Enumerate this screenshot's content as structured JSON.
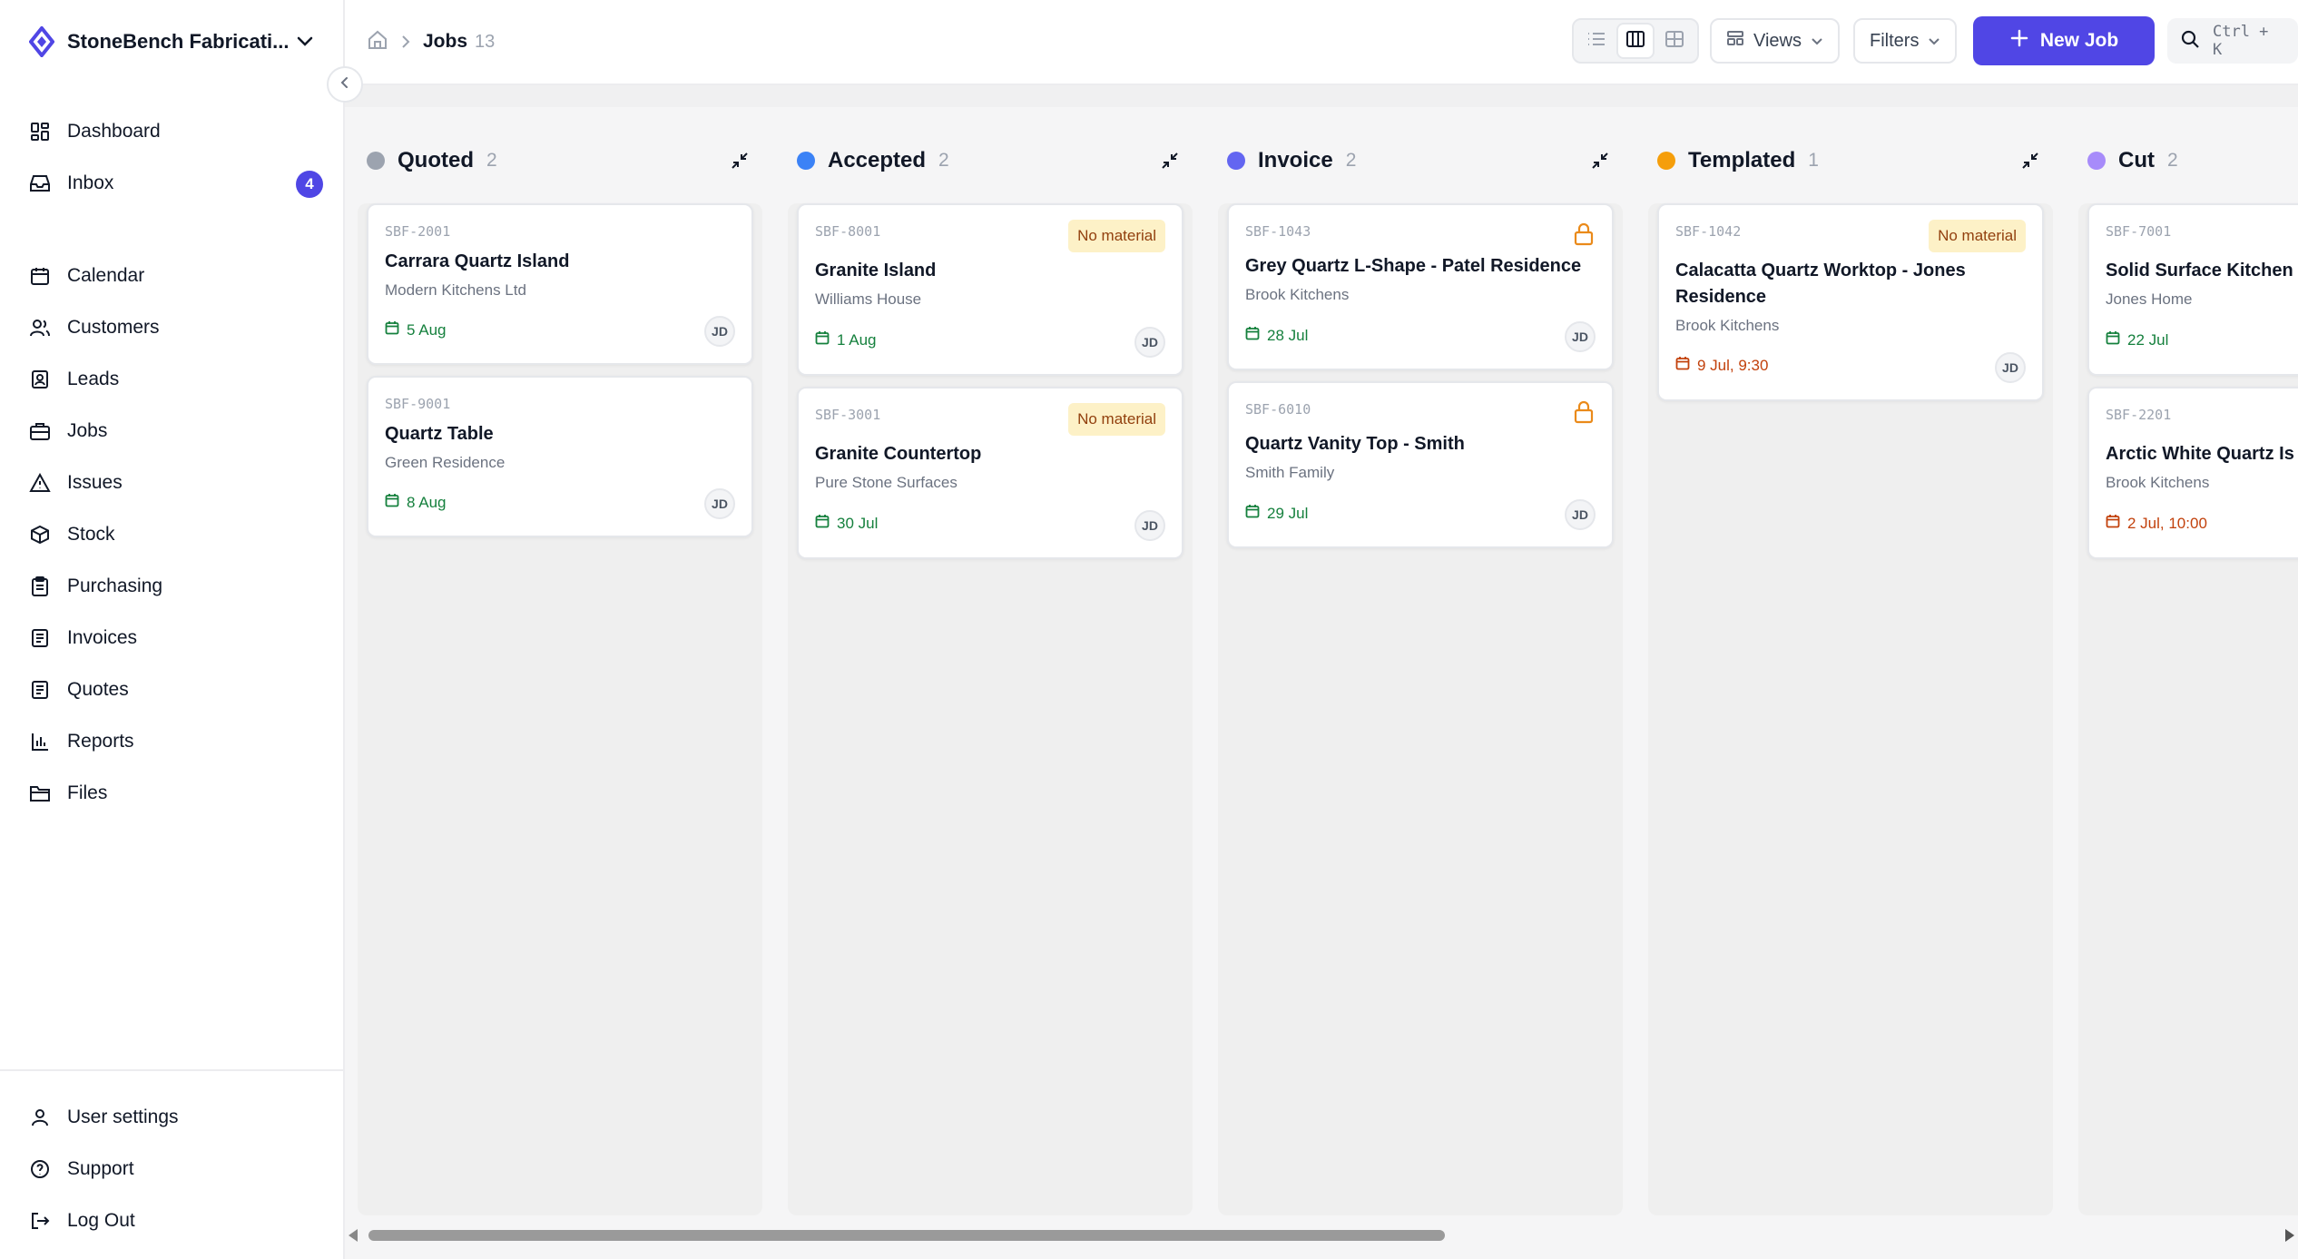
{
  "org": {
    "name": "StoneBench Fabricati..."
  },
  "sidebar": {
    "main_items": [
      {
        "label": "Dashboard",
        "icon": "dashboard-icon"
      },
      {
        "label": "Inbox",
        "icon": "inbox-icon",
        "badge": "4"
      }
    ],
    "items": [
      {
        "label": "Calendar",
        "icon": "calendar-icon"
      },
      {
        "label": "Customers",
        "icon": "users-icon"
      },
      {
        "label": "Leads",
        "icon": "contact-icon"
      },
      {
        "label": "Jobs",
        "icon": "briefcase-icon"
      },
      {
        "label": "Issues",
        "icon": "warning-icon"
      },
      {
        "label": "Stock",
        "icon": "box-icon"
      },
      {
        "label": "Purchasing",
        "icon": "clipboard-icon"
      },
      {
        "label": "Invoices",
        "icon": "document-icon"
      },
      {
        "label": "Quotes",
        "icon": "document-icon"
      },
      {
        "label": "Reports",
        "icon": "bar-chart-icon"
      },
      {
        "label": "Files",
        "icon": "folder-icon"
      }
    ],
    "footer_items": [
      {
        "label": "User settings",
        "icon": "user-icon"
      },
      {
        "label": "Support",
        "icon": "help-icon"
      },
      {
        "label": "Log Out",
        "icon": "logout-icon"
      }
    ]
  },
  "header": {
    "breadcrumb_title": "Jobs",
    "breadcrumb_count": "13",
    "views_label": "Views",
    "filters_label": "Filters",
    "new_job_label": "New Job",
    "search_shortcut": "Ctrl + K"
  },
  "colors": {
    "accent": "#5046e5",
    "quoted": "#9ca3af",
    "accepted": "#3b82f6",
    "invoice": "#6366f1",
    "templated": "#f59e0b",
    "cut": "#a78bfa"
  },
  "columns": [
    {
      "name": "Quoted",
      "count": "2",
      "cards": [
        {
          "id": "SBF-2001",
          "title": "Carrara Quartz Island",
          "customer": "Modern Kitchens Ltd",
          "date": "5 Aug",
          "assignee": "JD"
        },
        {
          "id": "SBF-9001",
          "title": "Quartz Table",
          "customer": "Green Residence",
          "date": "8 Aug",
          "assignee": "JD"
        }
      ]
    },
    {
      "name": "Accepted",
      "count": "2",
      "cards": [
        {
          "id": "SBF-8001",
          "title": "Granite Island",
          "customer": "Williams House",
          "date": "1 Aug",
          "assignee": "JD",
          "badge": "No material"
        },
        {
          "id": "SBF-3001",
          "title": "Granite Countertop",
          "customer": "Pure Stone Surfaces",
          "date": "30 Jul",
          "assignee": "JD",
          "badge": "No material"
        }
      ]
    },
    {
      "name": "Invoice",
      "count": "2",
      "cards": [
        {
          "id": "SBF-1043",
          "title": "Grey Quartz L-Shape - Patel Residence",
          "customer": "Brook Kitchens",
          "date": "28 Jul",
          "assignee": "JD",
          "locked": true
        },
        {
          "id": "SBF-6010",
          "title": "Quartz Vanity Top - Smith",
          "customer": "Smith Family",
          "date": "29 Jul",
          "assignee": "JD",
          "locked": true
        }
      ]
    },
    {
      "name": "Templated",
      "count": "1",
      "cards": [
        {
          "id": "SBF-1042",
          "title": "Calacatta Quartz Worktop - Jones Residence",
          "customer": "Brook Kitchens",
          "date": "9 Jul, 9:30",
          "assignee": "JD",
          "badge": "No material"
        }
      ]
    },
    {
      "name": "Cut",
      "count": "2",
      "cards": [
        {
          "id": "SBF-7001",
          "title": "Solid Surface Kitchen",
          "customer": "Jones Home",
          "date": "22 Jul"
        },
        {
          "id": "SBF-2201",
          "title": "Arctic White Quartz Is",
          "customer": "Brook Kitchens",
          "date": "2 Jul, 10:00"
        }
      ]
    }
  ]
}
